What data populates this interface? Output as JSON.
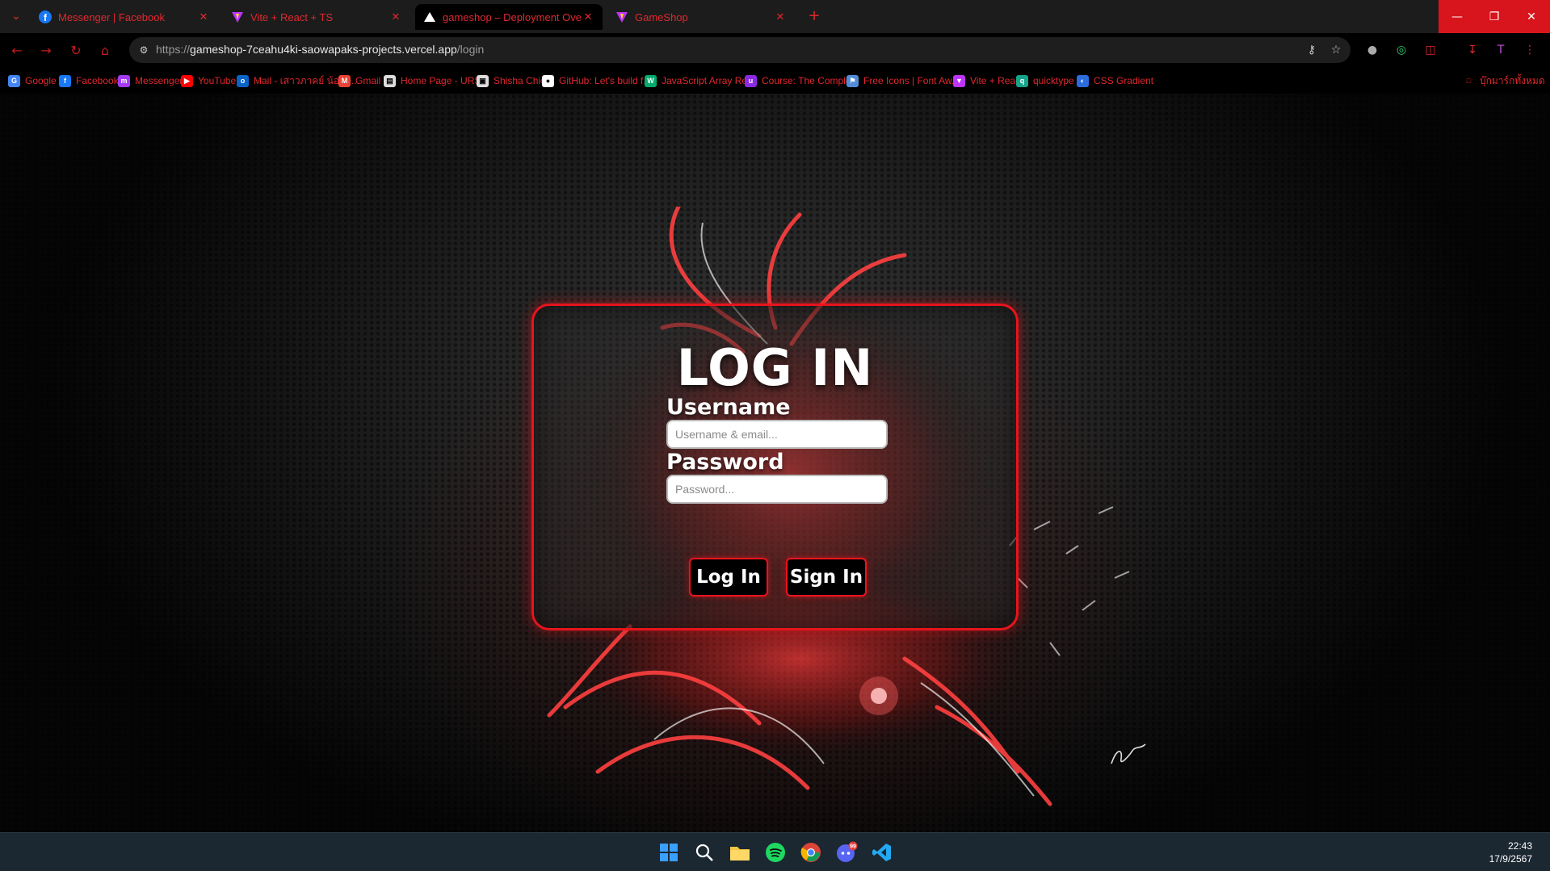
{
  "tabs": [
    {
      "title": "Messenger | Facebook",
      "favicon": "facebook-icon"
    },
    {
      "title": "Vite + React + TS",
      "favicon": "vite-icon"
    },
    {
      "title": "gameshop – Deployment Overv",
      "favicon": "vercel-icon"
    },
    {
      "title": "GameShop",
      "favicon": "vite-icon"
    }
  ],
  "toolbar": {
    "url_scheme": "https://",
    "url_host": "gameshop-7ceahu4ki-saowapaks-projects.vercel.app",
    "url_path": "/login"
  },
  "bookmarks": [
    {
      "label": "Google",
      "icon": "google-icon",
      "color": "#4285f4"
    },
    {
      "label": "Facebook",
      "icon": "facebook-icon",
      "color": "#1877f2"
    },
    {
      "label": "Messenger",
      "icon": "messenger-icon",
      "color": "#a33bf5"
    },
    {
      "label": "YouTube",
      "icon": "youtube-icon",
      "color": "#ff0000"
    },
    {
      "label": "Mail - เสาวภาคย์ น้อยม...",
      "icon": "outlook-icon",
      "color": "#0a64c8"
    },
    {
      "label": "Gmail",
      "icon": "gmail-icon",
      "color": "#ea4335"
    },
    {
      "label": "Home Page - URSA",
      "icon": "page-icon",
      "color": "#dddddd"
    },
    {
      "label": "Shisha Chic",
      "icon": "shisha-icon",
      "color": "#dddddd"
    },
    {
      "label": "GitHub: Let's build f...",
      "icon": "github-icon",
      "color": "#ffffff"
    },
    {
      "label": "JavaScript Array Ref...",
      "icon": "w3-icon",
      "color": "#04aa6d"
    },
    {
      "label": "Course: The Comple...",
      "icon": "course-icon",
      "color": "#8a2be2"
    },
    {
      "label": "Free Icons | Font Aw...",
      "icon": "flag-icon",
      "color": "#538dd7"
    },
    {
      "label": "Vite + React",
      "icon": "vite-icon",
      "color": "#bd34fe"
    },
    {
      "label": "quicktype",
      "icon": "quicktype-icon",
      "color": "#17a589"
    },
    {
      "label": "CSS Gradient",
      "icon": "gradient-icon",
      "color": "#2d6cdf"
    }
  ],
  "bookmarks_folder": "บุ๊กมาร์กทั้งหมด",
  "login": {
    "title": "LOG IN",
    "username_label": "Username",
    "username_placeholder": "Username & email...",
    "password_label": "Password",
    "password_placeholder": "Password...",
    "login_button": "Log In",
    "signin_button": "Sign In"
  },
  "colors": {
    "accent": "#e8141c",
    "page_bg": "#141414",
    "taskbar": "#1b2731"
  },
  "taskbar": {
    "apps": [
      "start-icon",
      "search-icon",
      "file-explorer-icon",
      "spotify-icon",
      "chrome-icon",
      "discord-icon",
      "vscode-icon"
    ],
    "discord_badge": "99",
    "time": "22:43",
    "date": "17/9/2567"
  }
}
